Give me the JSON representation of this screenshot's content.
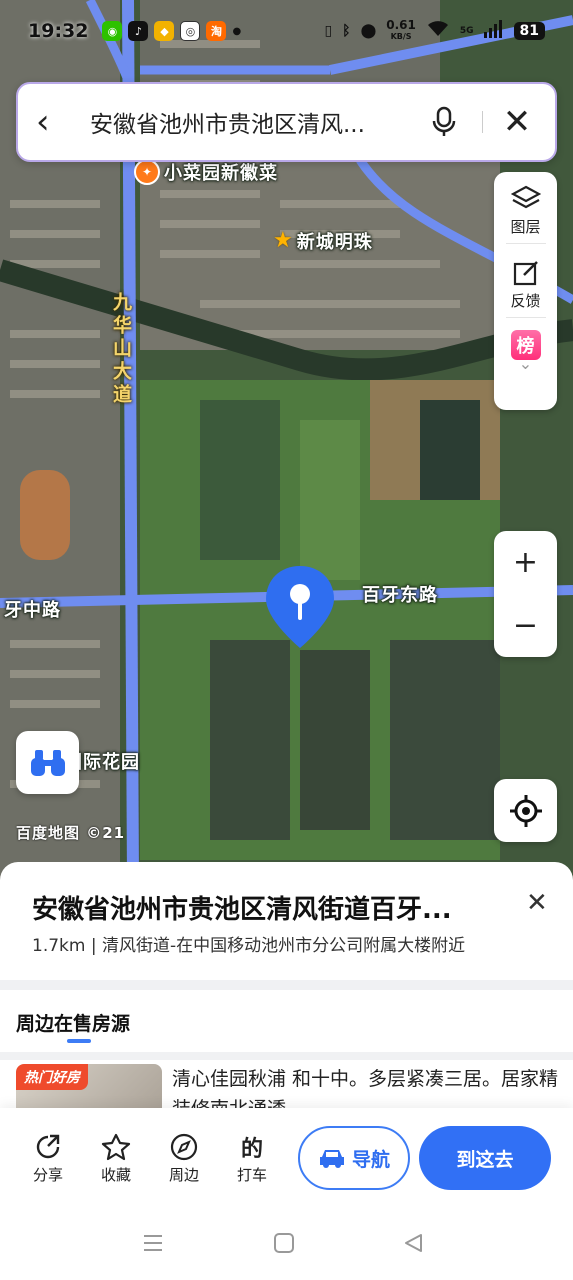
{
  "status_bar": {
    "time": "19:32",
    "net_speed_value": "0.61",
    "net_speed_unit": "KB/S",
    "signal_label": "5G",
    "battery": "81",
    "app_icons": [
      "wechat-icon",
      "tiktok-icon",
      "app-icon",
      "app-icon",
      "taobao-icon"
    ]
  },
  "search": {
    "query": "安徽省池州市贵池区清风..."
  },
  "map": {
    "labels": {
      "poi_restaurant": "小菜园新徽菜",
      "poi_estate": "新城明珠",
      "road_vertical": "九华山大道",
      "road_east": "百牙东路",
      "road_west": "牙中路",
      "poi_garden": "国际花园",
      "watermark": "百度地图 ©21"
    }
  },
  "tools": {
    "layers": "图层",
    "feedback": "反馈",
    "rank_icon_text": "榜"
  },
  "place": {
    "title": "安徽省池州市贵池区清风街道百牙...",
    "subtitle": "1.7km | 清风街道-在中国移动池州市分公司附属大楼附近"
  },
  "nearby": {
    "section_title": "周边在售房源",
    "badge": "热门好房",
    "listing_text": "清心佳园秋浦 和十中。多层紧凑三居。居家精装修南北通透"
  },
  "actions": {
    "share": "分享",
    "favorite": "收藏",
    "nearby": "周边",
    "taxi": "打车",
    "navigate": "导航",
    "go_here": "到这去"
  },
  "colors": {
    "primary_blue": "#3170f5",
    "rank_pink": "#ff2f7a",
    "hot_red": "#ef4b2c",
    "road_yellow": "#f4d46b"
  }
}
